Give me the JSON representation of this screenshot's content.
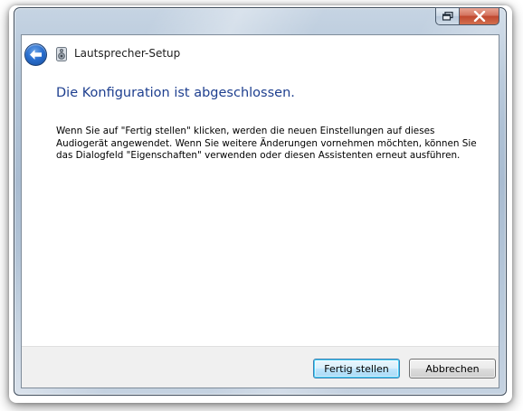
{
  "window": {
    "title": "Lautsprecher-Setup"
  },
  "icons": {
    "back": "back-arrow-icon",
    "app": "speaker-icon",
    "restore": "restore-icon",
    "close": "close-icon"
  },
  "content": {
    "heading": "Die Konfiguration ist abgeschlossen.",
    "body": "Wenn Sie auf \"Fertig stellen\" klicken, werden die neuen Einstellungen auf dieses Audiogerät angewendet. Wenn Sie weitere Änderungen vornehmen möchten, können Sie das Dialogfeld \"Eigenschaften\" verwenden oder diesen Assistenten erneut ausführen."
  },
  "footer": {
    "finish_label": "Fertig stellen",
    "cancel_label": "Abbrechen"
  },
  "colors": {
    "heading": "#1e3f8f",
    "close_button": "#c0472f",
    "default_button_border": "#3c7fb1"
  }
}
